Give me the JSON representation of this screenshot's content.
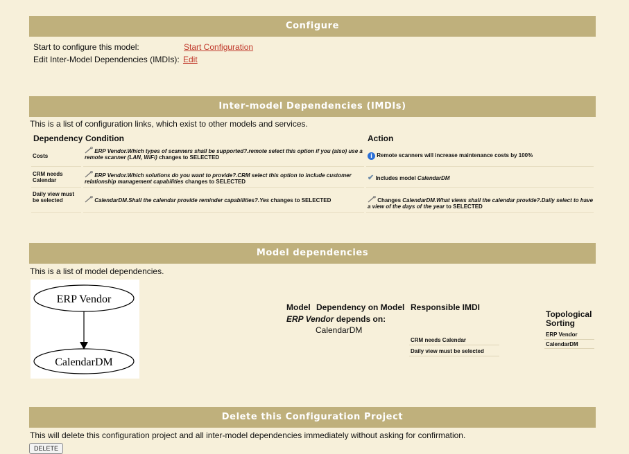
{
  "configure": {
    "title": "Configure",
    "start_label": "Start to configure this model:",
    "start_link": "Start Configuration",
    "edit_label": "Edit Inter-Model Dependencies (IMDIs):",
    "edit_link": "Edit"
  },
  "imdi": {
    "title": "Inter-model Dependencies (IMDIs)",
    "intro": "This is a list of configuration links, which exist to other models and services.",
    "headers": {
      "dependency": "Dependency",
      "condition": "Condition",
      "action": "Action"
    },
    "rows": [
      {
        "dependency": "Costs",
        "condition_italic": "ERP Vendor.Which types of scanners shall be supported?.remote select this option if you (also) use a remote scanner (LAN, WiFi)",
        "condition_suffix": "changes to SELECTED",
        "action_icon": "info-icon",
        "action_text": "Remote scanners will increase maintenance costs by 100%"
      },
      {
        "dependency": "CRM needs Calendar",
        "condition_italic": "ERP Vendor.Which solutions do you want to provide?.CRM select this option to include customer relationship management capabilities",
        "condition_suffix": "changes to SELECTED",
        "action_icon": "checkmark-icon",
        "action_prefix": "Includes model",
        "action_italic": "CalendarDM"
      },
      {
        "dependency": "Daily view must be selected",
        "condition_italic": "CalendarDM.Shall the calendar provide reminder capabilities?.Yes",
        "condition_suffix": "changes to SELECTED",
        "action_icon": "wrench-icon",
        "action_prefix": "Changes",
        "action_italic": "CalendarDM.What views shall the calendar provide?.Daily select to have a view of the days of the year",
        "action_suffix": "to SELECTED"
      }
    ]
  },
  "model_deps": {
    "title": "Model dependencies",
    "intro": "This is a list of model dependencies.",
    "graph": {
      "node_top": "ERP Vendor",
      "node_bottom": "CalendarDM"
    },
    "col_model": "Model",
    "col_dependency": "Dependency on Model",
    "col_imdi": "Responsible IMDI",
    "model_italic": "ERP Vendor",
    "depends_on": "depends on:",
    "dep_model": "CalendarDM",
    "imdis": [
      "CRM needs Calendar",
      "Daily view must be selected"
    ],
    "topo_title": "Topological Sorting",
    "topo_items": [
      "ERP Vendor",
      "CalendarDM"
    ]
  },
  "delete": {
    "title": "Delete this Configuration Project",
    "text": "This will delete this configuration project and all inter-model dependencies immediately without asking for confirmation.",
    "button": "DELETE"
  },
  "colors": {
    "bar": "#bfb07c",
    "background": "#f7f0da",
    "link": "#c0392b"
  }
}
